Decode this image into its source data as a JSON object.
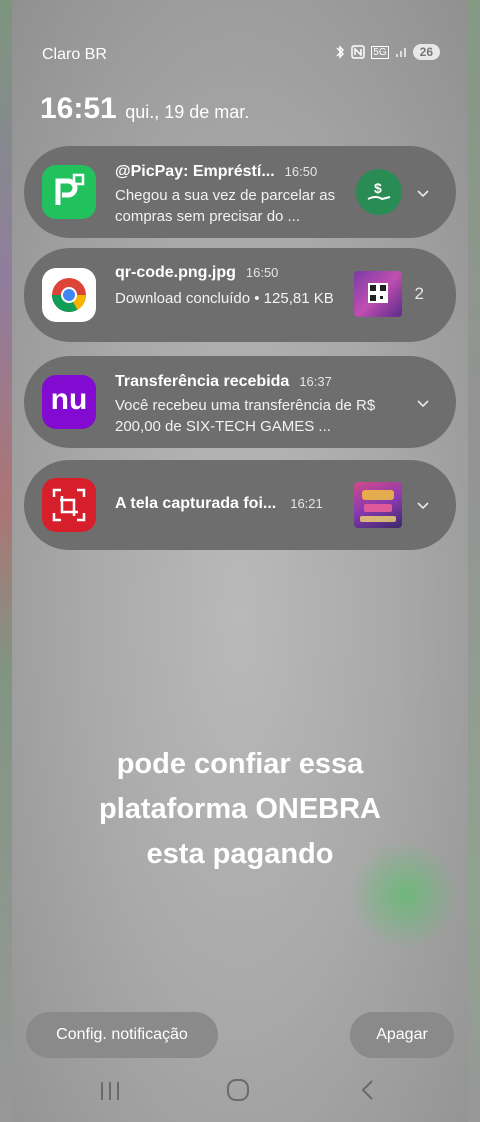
{
  "status_bar": {
    "carrier": "Claro BR",
    "network": "5G",
    "battery": "26"
  },
  "clock": {
    "time": "16:51",
    "date": "qui., 19 de mar."
  },
  "notifications": [
    {
      "app": "PicPay",
      "title": "@PicPay: Empréstí...",
      "time": "16:50",
      "body": "Chegou a sua vez de parcelar as compras sem precisar do ...",
      "icon": "picpay-icon",
      "action_icon": "money-hand-icon"
    },
    {
      "app": "Chrome",
      "title": "qr-code.png.jpg",
      "time": "16:50",
      "body": "Download concluído • 125,81 KB",
      "icon": "chrome-icon",
      "count": "2"
    },
    {
      "app": "Nubank",
      "title": "Transferência recebida",
      "time": "16:37",
      "body": "Você recebeu uma transferência de R$ 200,00 de SIX-TECH GAMES ...",
      "icon": "nubank-icon",
      "icon_text": "nu"
    },
    {
      "app": "Screenshot",
      "title": "A tela capturada foi...",
      "time": "16:21",
      "icon": "screenshot-icon"
    }
  ],
  "overlay_caption": [
    "pode confiar essa",
    "plataforma ONEBRA",
    "esta pagando"
  ],
  "buttons": {
    "settings": "Config. notificação",
    "clear": "Apagar"
  },
  "colors": {
    "picpay": "#21c25e",
    "nubank": "#820ad1",
    "screenshot": "#d71f2b"
  }
}
